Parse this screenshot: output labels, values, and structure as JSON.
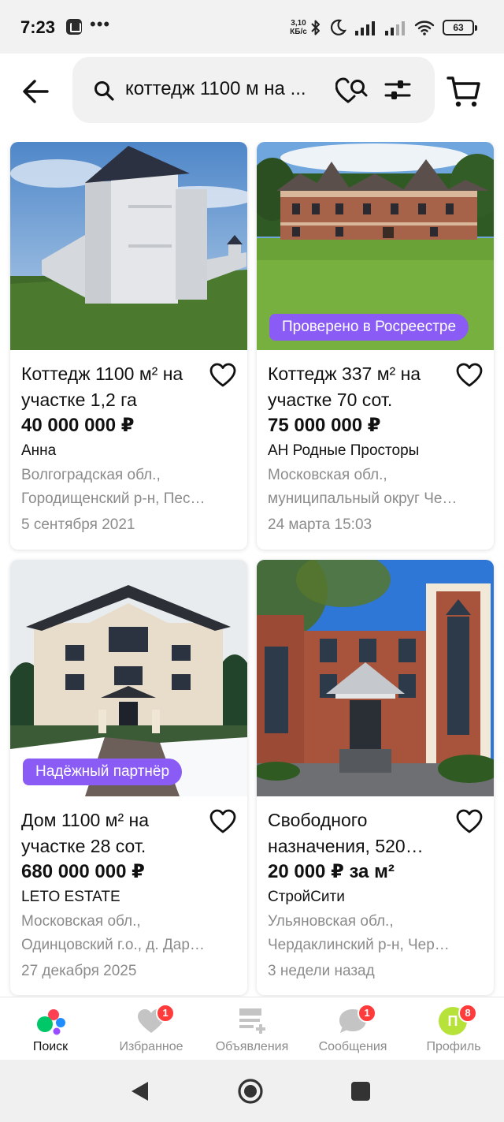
{
  "status_bar": {
    "time": "7:23",
    "dots": "•••",
    "speed_value": "3,10",
    "speed_unit": "КБ/с",
    "battery": "63"
  },
  "search": {
    "query": "коттедж 1100 м на ..."
  },
  "listings": [
    {
      "title_line1": "Коттедж 1100 м² на",
      "title_line2": "участке 1,2 га",
      "price": "40 000 000 ₽",
      "seller": "Анна",
      "location_line1": "Волгоградская обл.,",
      "location_line2": "Городищенский р-н, Пес…",
      "date": "5 сентября 2021",
      "badge": ""
    },
    {
      "title_line1": "Коттедж 337 м² на",
      "title_line2": "участке 70 сот.",
      "price": "75 000 000 ₽",
      "seller": "АН Родные Просторы",
      "location_line1": "Московская обл.,",
      "location_line2": "муниципальный округ Че…",
      "date": "24 марта 15:03",
      "badge": "Проверено в Росреестре"
    },
    {
      "title_line1": "Дом 1100 м² на",
      "title_line2": "участке 28 сот.",
      "price": "680 000 000 ₽",
      "seller": "LETO ESTATE",
      "location_line1": "Московская обл.,",
      "location_line2": "Одинцовский г.о., д. Дар…",
      "date": "27 декабря 2025",
      "badge": "Надёжный партнёр"
    },
    {
      "title_line1": "Свободного",
      "title_line2": "назначения, 520…",
      "price": "20 000 ₽ за м²",
      "seller": "СтройСити",
      "location_line1": "Ульяновская обл.,",
      "location_line2": "Чердаклинский р-н, Чер…",
      "date": "3 недели назад",
      "badge": ""
    }
  ],
  "bottom_nav": [
    {
      "label": "Поиск",
      "badge": "",
      "icon": "search-home-icon",
      "active": true
    },
    {
      "label": "Избранное",
      "badge": "1",
      "icon": "heart-icon",
      "active": false
    },
    {
      "label": "Объявления",
      "badge": "",
      "icon": "ads-list-icon",
      "active": false
    },
    {
      "label": "Сообщения",
      "badge": "1",
      "icon": "chat-icon",
      "active": false
    },
    {
      "label": "Профиль",
      "badge": "8",
      "avatar_letter": "П",
      "icon": "avatar",
      "active": false
    }
  ],
  "colors": {
    "badge_purple": "#8a5cf5",
    "notification_red": "#ff3b3b",
    "avatar_green": "#b6e23a",
    "muted_text": "#8b8b8b"
  }
}
